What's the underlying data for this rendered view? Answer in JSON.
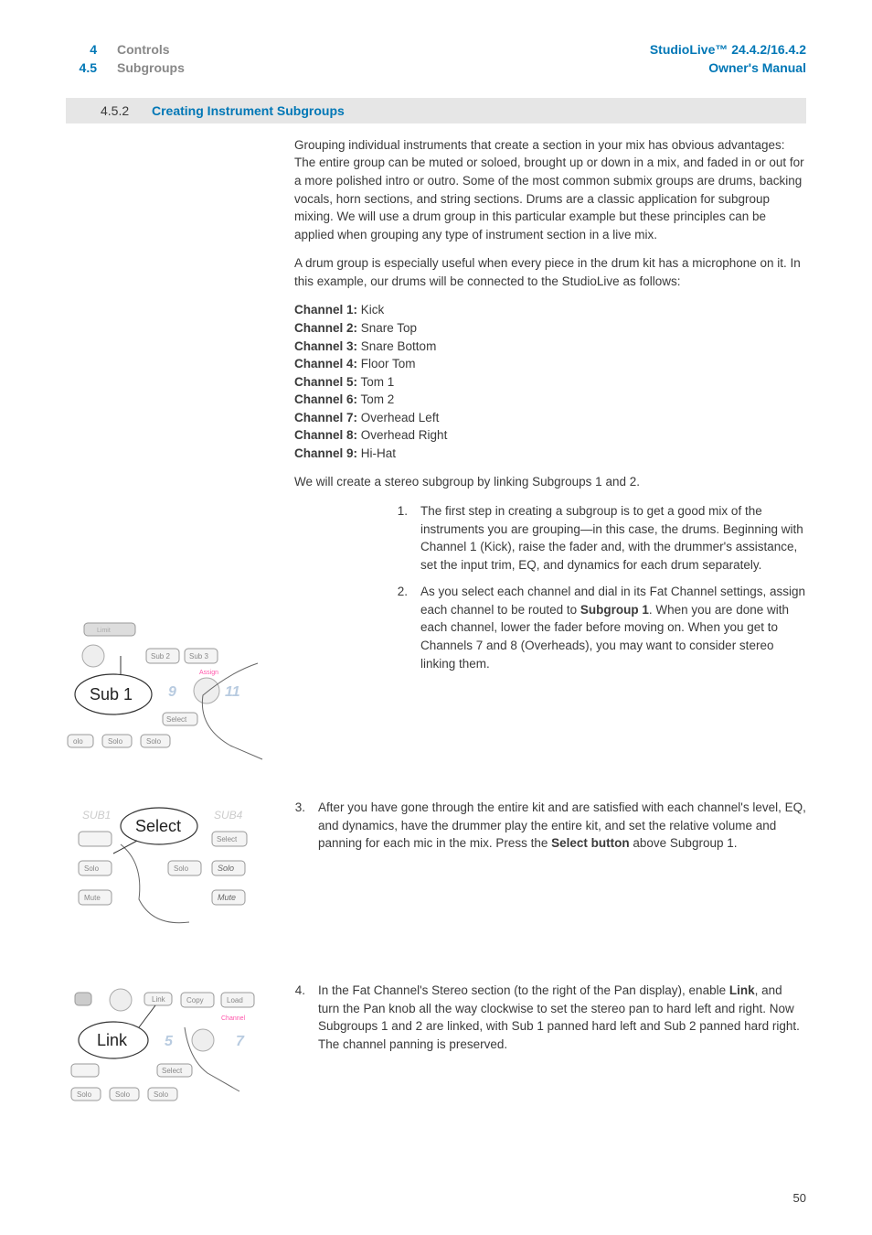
{
  "header": {
    "left_num_top": "4",
    "left_txt_top": "Controls",
    "left_num_bot": "4.5",
    "left_txt_bot": "Subgroups",
    "right_top": "StudioLive™ 24.4.2/16.4.2",
    "right_bot": "Owner's Manual"
  },
  "section": {
    "num": "4.5.2",
    "title": "Creating Instrument Subgroups"
  },
  "para1": "Grouping individual instruments that create a section in your mix has obvious advantages: The entire group can be muted or soloed, brought up or down in a mix, and faded in or out for a more polished intro or outro. Some of the most common submix groups are drums, backing vocals, horn sections, and string sections. Drums are a classic application for subgroup mixing. We will use a drum group in this particular example but these principles can be applied when grouping any type of instrument section in a live mix.",
  "para2": "A drum group is especially useful when every piece in the drum kit has a microphone on it. In this example, our drums will be connected to the StudioLive as follows:",
  "channels": [
    {
      "label": "Channel 1:",
      "value": " Kick"
    },
    {
      "label": "Channel 2:",
      "value": " Snare Top"
    },
    {
      "label": "Channel 3:",
      "value": " Snare Bottom"
    },
    {
      "label": "Channel 4:",
      "value": " Floor Tom"
    },
    {
      "label": "Channel 5:",
      "value": " Tom 1"
    },
    {
      "label": "Channel 6:",
      "value": " Tom 2"
    },
    {
      "label": "Channel 7:",
      "value": " Overhead Left"
    },
    {
      "label": "Channel 8:",
      "value": " Overhead Right"
    },
    {
      "label": "Channel 9:",
      "value": " Hi-Hat"
    }
  ],
  "para3": "We will create a stereo subgroup by linking Subgroups 1 and 2.",
  "steps": {
    "s1": {
      "num": "1.",
      "txt": "The first step in creating a subgroup is to get a good mix of the instruments you are grouping—in this case, the drums. Beginning with Channel 1 (Kick), raise the fader and, with the drummer's assistance, set the input trim, EQ, and dynamics for each drum separately."
    },
    "s2": {
      "num": "2.",
      "pre": "As you select each channel and dial in its Fat Channel settings, assign each channel to be routed to ",
      "bold": "Subgroup 1",
      "post": ". When you are done with each channel, lower the fader before moving on. When you get to Channels 7 and 8 (Overheads), you may want to consider stereo linking them."
    },
    "s3": {
      "num": "3.",
      "pre": "After you have gone through the entire kit and are satisfied with each channel's level, EQ, and dynamics, have the drummer play the entire kit, and set the relative volume and panning for each mic in the mix. Press the ",
      "bold": "Select button",
      "post": " above Subgroup 1."
    },
    "s4": {
      "num": "4.",
      "pre": "In the Fat Channel's Stereo section (to the right of the Pan display), enable ",
      "bold": "Link",
      "post": ", and turn the Pan knob all the way clockwise to set the stereo pan to hard left and right. Now Subgroups 1 and 2 are linked, with Sub 1 panned hard left and Sub 2 panned hard right. The channel panning is preserved."
    }
  },
  "illus": {
    "i1": {
      "limit": "Limit",
      "sub2": "Sub 2",
      "sub3": "Sub 3",
      "assign": "Assign",
      "n9": "9",
      "n11": "11",
      "select": "Select",
      "solo": "Solo",
      "olo": "olo",
      "callout": "Sub 1"
    },
    "i2": {
      "sub1": "SUB1",
      "sub4": "SUB4",
      "select": "Select",
      "solo": "Solo",
      "mute": "Mute",
      "callout": "Select"
    },
    "i3": {
      "copy": "Copy",
      "load": "Load",
      "channel": "Channel",
      "n5": "5",
      "n7": "7",
      "select": "Select",
      "solo": "Solo",
      "callout": "Link",
      "link_btn": "Link"
    }
  },
  "page_num": "50"
}
